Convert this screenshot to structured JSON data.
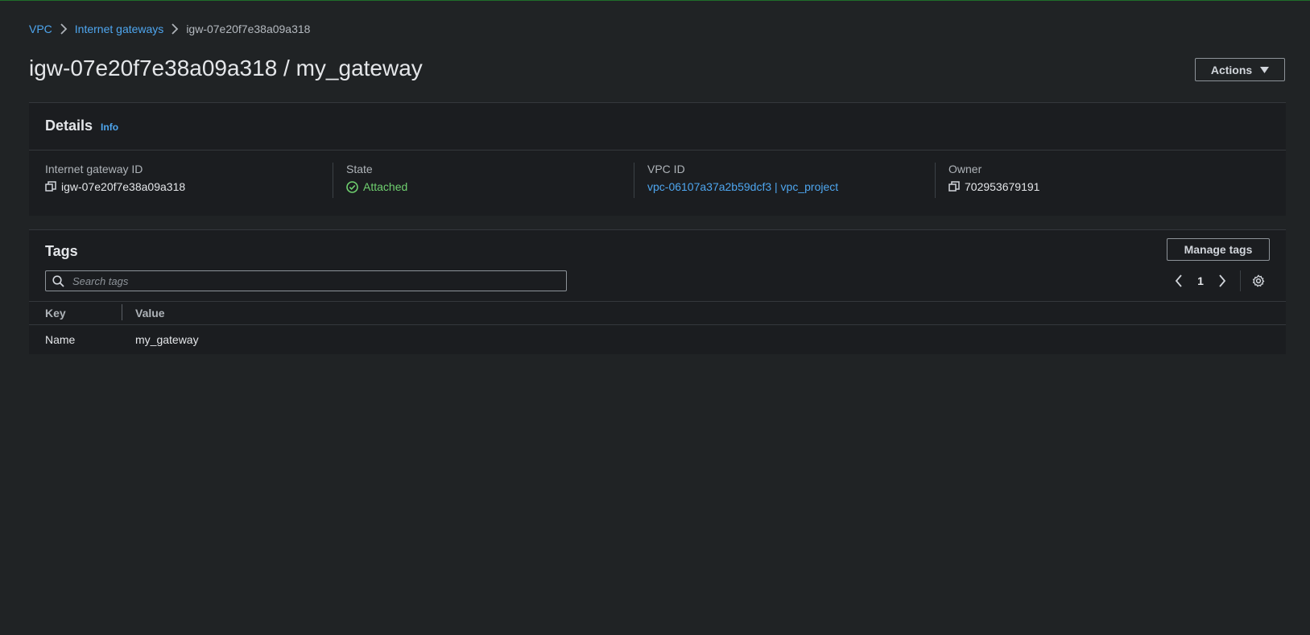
{
  "breadcrumb": {
    "items": [
      "VPC",
      "Internet gateways"
    ],
    "current": "igw-07e20f7e38a09a318"
  },
  "page": {
    "title": "igw-07e20f7e38a09a318 / my_gateway",
    "actions_label": "Actions"
  },
  "details": {
    "title": "Details",
    "info": "Info",
    "fields": {
      "gateway_id": {
        "label": "Internet gateway ID",
        "value": "igw-07e20f7e38a09a318"
      },
      "state": {
        "label": "State",
        "value": "Attached"
      },
      "vpc_id": {
        "label": "VPC ID",
        "value": "vpc-06107a37a2b59dcf3 | vpc_project"
      },
      "owner": {
        "label": "Owner",
        "value": "702953679191"
      }
    }
  },
  "tags": {
    "title": "Tags",
    "manage_label": "Manage tags",
    "search_placeholder": "Search tags",
    "page_number": "1",
    "columns": {
      "key": "Key",
      "value": "Value"
    },
    "rows": [
      {
        "key": "Name",
        "value": "my_gateway"
      }
    ]
  },
  "colors": {
    "background": "#202325",
    "panel": "#1b1d20",
    "link": "#4ea6ef",
    "success": "#6fd06f"
  },
  "icons": [
    "chevron-right-icon",
    "caret-down-icon",
    "copy-icon",
    "status-check-icon",
    "search-icon",
    "chevron-left-icon",
    "settings-gear-icon"
  ]
}
